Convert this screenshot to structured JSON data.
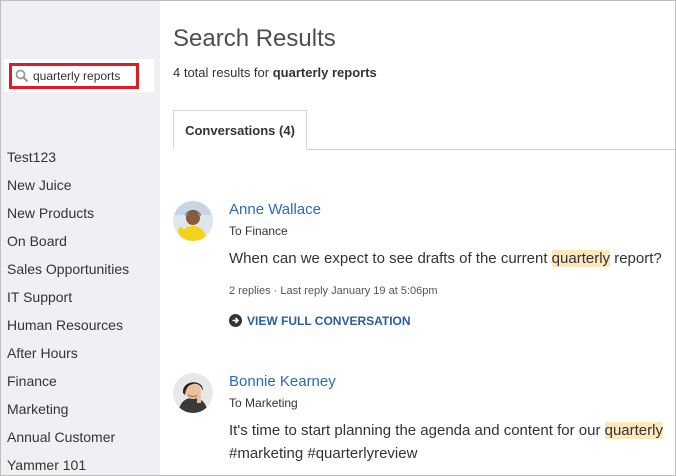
{
  "search": {
    "query": "quarterly reports"
  },
  "sidebar": {
    "items": [
      {
        "label": "Test123"
      },
      {
        "label": "New Juice"
      },
      {
        "label": "New Products"
      },
      {
        "label": "On Board"
      },
      {
        "label": "Sales Opportunities"
      },
      {
        "label": "IT Support"
      },
      {
        "label": "Human Resources"
      },
      {
        "label": "After Hours"
      },
      {
        "label": "Finance"
      },
      {
        "label": "Marketing"
      },
      {
        "label": "Annual Customer"
      },
      {
        "label": "Yammer 101"
      }
    ]
  },
  "main": {
    "title": "Search Results",
    "summary_prefix": "4 total results for",
    "summary_query": "quarterly reports",
    "tab_label": "Conversations (4)"
  },
  "results": [
    {
      "author": "Anne Wallace",
      "to_prefix": "To",
      "group": "Finance",
      "text_before": "When can we expect to see drafts of the current ",
      "highlight": "quarterly",
      "text_after": " report?",
      "meta": "2 replies · Last reply January 19 at 5:06pm",
      "link": "VIEW FULL CONVERSATION"
    },
    {
      "author": "Bonnie Kearney",
      "to_prefix": "To",
      "group": "Marketing",
      "text_before": "It's time to start planning the agenda and content for our ",
      "highlight": "quarterly",
      "text_after": " #marketing #quarterlyreview"
    }
  ],
  "colors": {
    "link_blue": "#2a6bb7",
    "highlight": "#fde8bd",
    "search_border": "#e11b22",
    "sidebar_bg": "#eff0f3"
  }
}
